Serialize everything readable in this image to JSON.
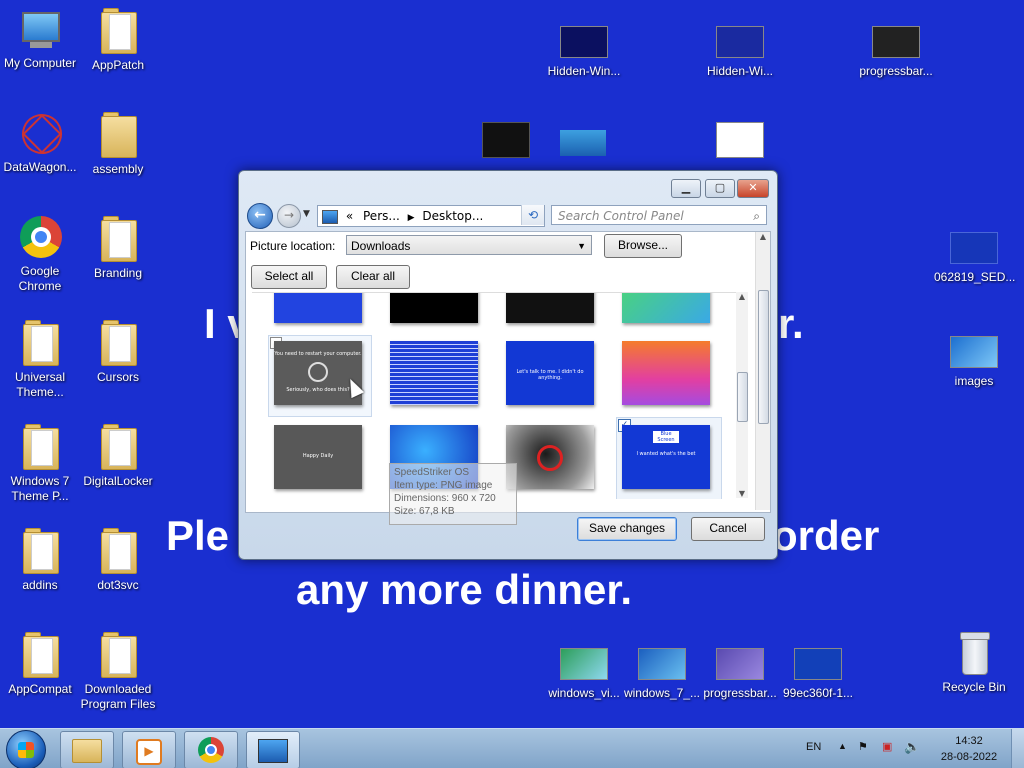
{
  "background_text": {
    "line1": "I v",
    "line1b": "r.",
    "line2": "Ple",
    "line2b": "order",
    "line3": "any more dinner."
  },
  "desktop_icons": {
    "my_computer": "My Computer",
    "apppatch": "AppPatch",
    "datawagon": "DataWagon...",
    "assembly": "assembly",
    "google_chrome": "Google Chrome",
    "branding": "Branding",
    "universal_theme": "Universal Theme...",
    "cursors": "Cursors",
    "win7_theme": "Windows 7 Theme P...",
    "digitallocker": "DigitalLocker",
    "addins": "addins",
    "dot3svc": "dot3svc",
    "appcompat": "AppCompat",
    "downloaded_program_files": "Downloaded Program Files",
    "hidden_win_1": "Hidden-Win...",
    "hidden_win_2": "Hidden-Wi...",
    "progressbar_1": "progressbar...",
    "file_062819": "062819_SED...",
    "images": "images",
    "windows_vi": "windows_vi...",
    "windows_7": "windows_7_...",
    "progressbar_2": "progressbar...",
    "file_99ec": "99ec360f-1...",
    "recycle_bin": "Recycle Bin"
  },
  "dialog": {
    "breadcrumb": {
      "prefix": "«",
      "part1": "Pers...",
      "part2": "Desktop..."
    },
    "search_placeholder": "Search Control Panel",
    "picture_location_label": "Picture location:",
    "picture_location_value": "Downloads",
    "browse_label": "Browse...",
    "select_all_label": "Select all",
    "clear_all_label": "Clear all",
    "save_label": "Save changes",
    "cancel_label": "Cancel",
    "tooltip": {
      "name": "SpeedStriker OS",
      "type": "Item type: PNG image",
      "dimensions": "Dimensions: 960 x 720",
      "size": "Size: 67,8 KB"
    },
    "tiles": {
      "restart_text": "You need to restart your computer.",
      "restart_sub": "Seriously, who does this?",
      "blue_text": "Let's talk to me. I didn't do anything.",
      "gray_text": "Happy Daily",
      "error_title": "Blue Screen",
      "error_text": "I wanted what's the bet"
    }
  },
  "taskbar": {
    "language": "EN",
    "time": "14:32",
    "date": "28-08-2022"
  },
  "colors": {
    "desktop_bg": "#1a2fd0",
    "accent": "#3c7fd8"
  }
}
